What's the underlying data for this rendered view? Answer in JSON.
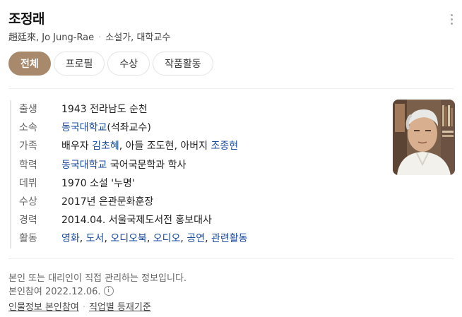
{
  "person": {
    "name": "조정래",
    "hanja_en": "趙廷來, Jo Jung-Rae",
    "occupation": "소설가, 대학교수"
  },
  "tabs": [
    {
      "label": "전체",
      "active": true
    },
    {
      "label": "프로필",
      "active": false
    },
    {
      "label": "수상",
      "active": false
    },
    {
      "label": "작품활동",
      "active": false
    }
  ],
  "profile": {
    "birth": {
      "label": "출생",
      "value": "1943 전라남도 순천"
    },
    "affiliation": {
      "label": "소속",
      "link": "동국대학교",
      "rest": "(석좌교수)"
    },
    "family": {
      "label": "가족",
      "prefix": "배우자 ",
      "spouse": "김초혜",
      "middle": ", 아들 조도현, 아버지 ",
      "father": "조종현"
    },
    "education": {
      "label": "학력",
      "link": "동국대학교",
      "rest": " 국어국문학과 학사"
    },
    "debut": {
      "label": "데뷔",
      "value": "1970 소설 '누명'"
    },
    "award": {
      "label": "수상",
      "value": "2017년 은관문화훈장"
    },
    "career": {
      "label": "경력",
      "value": "2014.04. 서울국제도서전 홍보대사"
    },
    "activities": {
      "label": "활동",
      "items": [
        "영화",
        "도서",
        "오디오북",
        "오디오",
        "공연",
        "관련활동"
      ],
      "sep": ", "
    }
  },
  "footer": {
    "managed_notice": "본인 또는 대리인이 직접 관리하는 정보입니다.",
    "participation": "본인참여 2022.12.06.",
    "info_icon": "i",
    "links": [
      "인물정보 본인참여",
      "직업별 등재기준"
    ]
  },
  "colors": {
    "accent": "#a8896b",
    "link": "#1a4ba0"
  },
  "icons": {
    "more": "more-vertical-icon",
    "info": "info-circle-icon"
  }
}
